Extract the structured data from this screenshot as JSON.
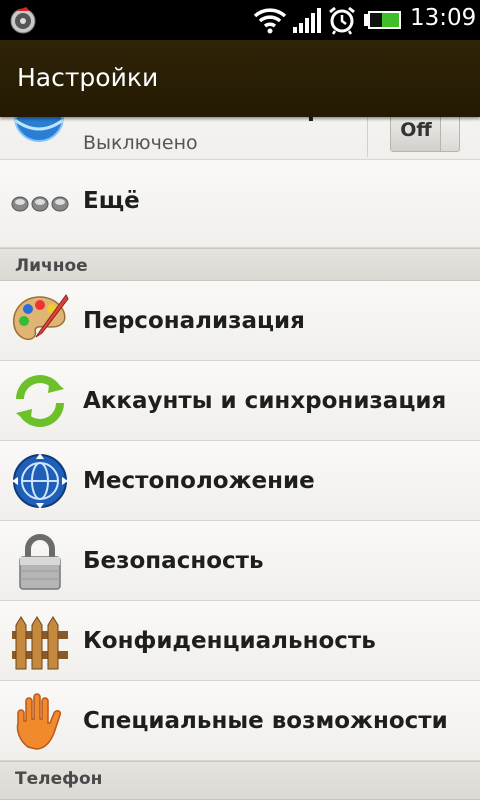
{
  "status_bar": {
    "time": "13:09",
    "icons": [
      "app-notification-icon",
      "wifi-icon",
      "signal-icon",
      "alarm-icon",
      "battery-icon"
    ],
    "battery_color": "#3fc02a"
  },
  "header": {
    "title": "Настройки",
    "background": "#2a1f05"
  },
  "mobile_data": {
    "label": "Мобильный интернет",
    "sublabel": "Выключено",
    "toggle_label": "Off",
    "icon": "globe-network-icon"
  },
  "more": {
    "label": "Ещё",
    "icon": "more-dots-icon"
  },
  "sections": {
    "personal": "Личное",
    "phone": "Телефон"
  },
  "personal_items": [
    {
      "label": "Персонализация",
      "icon": "palette-icon"
    },
    {
      "label": "Аккаунты и синхронизация",
      "icon": "sync-icon"
    },
    {
      "label": "Местоположение",
      "icon": "location-globe-icon"
    },
    {
      "label": "Безопасность",
      "icon": "lock-icon"
    },
    {
      "label": "Конфиденциальность",
      "icon": "fence-icon"
    },
    {
      "label": "Специальные возможности",
      "icon": "hand-icon"
    }
  ]
}
